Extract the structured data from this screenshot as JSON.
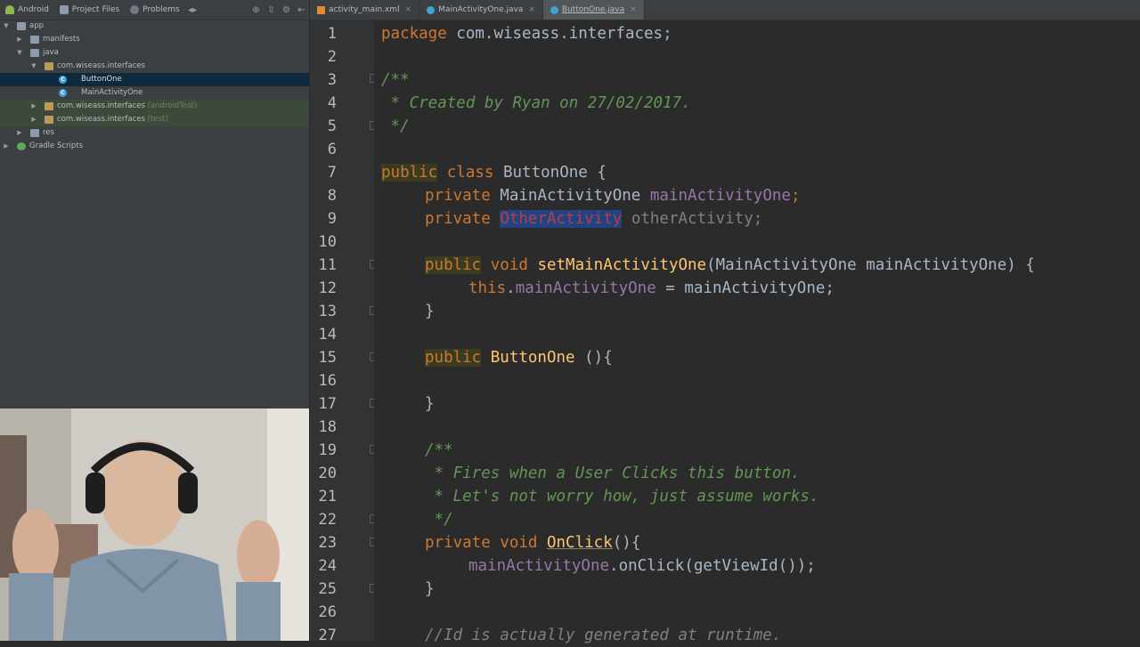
{
  "project_panel": {
    "tabs": [
      "Android",
      "Project Files",
      "Problems"
    ],
    "tree": [
      {
        "label": "app",
        "depth": 0,
        "expanded": true,
        "icon": "folder-icon"
      },
      {
        "label": "manifests",
        "depth": 1,
        "expanded": false,
        "icon": "folder-icon"
      },
      {
        "label": "java",
        "depth": 1,
        "expanded": true,
        "icon": "folder-icon"
      },
      {
        "label": "com.wiseass.interfaces",
        "depth": 2,
        "expanded": true,
        "icon": "package-icon"
      },
      {
        "label": "ButtonOne",
        "depth": 3,
        "icon": "class-icon",
        "selected": true
      },
      {
        "label": "MainActivityOne",
        "depth": 3,
        "icon": "class-icon"
      },
      {
        "label": "com.wiseass.interfaces",
        "suffix": "(androidTest)",
        "depth": 2,
        "expanded": false,
        "icon": "package-icon"
      },
      {
        "label": "com.wiseass.interfaces",
        "suffix": "(test)",
        "depth": 2,
        "expanded": false,
        "icon": "package-icon"
      },
      {
        "label": "res",
        "depth": 1,
        "expanded": false,
        "icon": "folder-icon"
      },
      {
        "label": "Gradle Scripts",
        "depth": 0,
        "expanded": false,
        "icon": "gradle-icon"
      }
    ]
  },
  "editor_tabs": [
    {
      "label": "activity_main.xml",
      "icon": "xml-file-icon",
      "active": false
    },
    {
      "label": "MainActivityOne.java",
      "icon": "java-class-icon",
      "active": false
    },
    {
      "label": "ButtonOne.java",
      "icon": "java-class-icon",
      "active": true
    }
  ],
  "line_numbers": [
    "1",
    "2",
    "3",
    "4",
    "5",
    "6",
    "7",
    "8",
    "9",
    "10",
    "11",
    "12",
    "13",
    "14",
    "15",
    "16",
    "17",
    "18",
    "19",
    "20",
    "21",
    "22",
    "23",
    "24",
    "25",
    "26",
    "27"
  ],
  "code": {
    "l1_kw": "package",
    "l1_rest": " com.wiseass.interfaces;",
    "l3": "/**",
    "l4": " * Created by Ryan on 27/02/2017.",
    "l5": " */",
    "l7_kw": "public",
    "l7_kw2": " class",
    "l7_rest": " ButtonOne {",
    "l8_kw": "private",
    "l8_type": " MainActivityOne ",
    "l8_field": "mainActivityOne",
    "l8_end": ";",
    "l9_kw": "private",
    "l9_type": "OtherActivity",
    "l9_field": "otherActivity",
    "l9_end": ";",
    "l11_kw": "public",
    "l11_kw2": " void ",
    "l11_fn": "setMainActivityOne",
    "l11_rest": "(MainActivityOne mainActivityOne) {",
    "l12_kw": "this",
    "l12_dot": ".",
    "l12_field": "mainActivityOne",
    "l12_rest": " = mainActivityOne;",
    "l13": "}",
    "l15_kw": "public",
    "l15_fn": " ButtonOne ",
    "l15_rest": "(){",
    "l17": "}",
    "l19": "/**",
    "l20": " * Fires when a User Clicks this button.",
    "l21": " * Let's not worry how, just assume works.",
    "l22": " */",
    "l23_kw": "private void",
    "l23_fn": "OnClick",
    "l23_rest": "(){",
    "l24_field": "mainActivityOne",
    "l24_rest": ".onClick(getViewId());",
    "l25": "}",
    "l27": "//Id is actually generated at runtime."
  },
  "colors": {
    "keyword": "#cc7832",
    "field": "#9876aa",
    "method": "#ffc66d",
    "doc_comment": "#629755",
    "error": "#bc3f3c"
  }
}
